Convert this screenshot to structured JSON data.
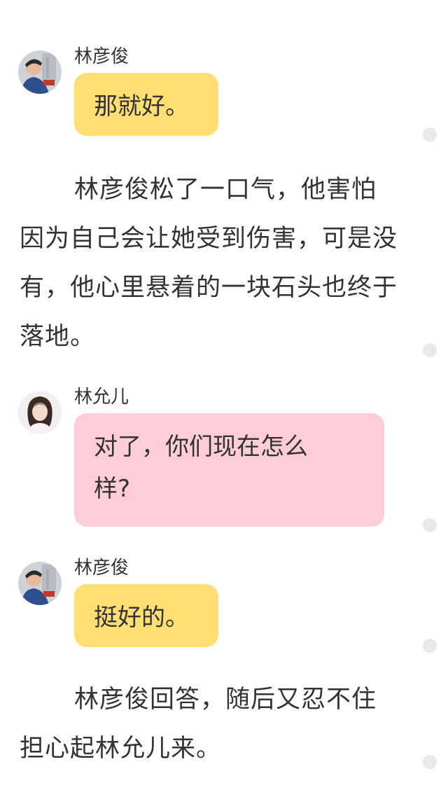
{
  "messages": [
    {
      "sender": "林彦俊",
      "text": "那就好。",
      "style": "yellow"
    },
    {
      "sender": "林允儿",
      "text": "对了，你们现在怎么样?",
      "style": "pink"
    },
    {
      "sender": "林彦俊",
      "text": "挺好的。",
      "style": "yellow"
    }
  ],
  "narrations": [
    "林彦俊松了一口气，他害怕因为自己会让她受到伤害，可是没有，他心里悬着的一块石头也终于落地。",
    "林彦俊回答，随后又忍不住担心起林允儿来。"
  ],
  "colors": {
    "yellow_bubble": "#ffdf73",
    "pink_bubble": "#ffcdd8",
    "text": "#333333",
    "side_dot": "#e9e9e9"
  }
}
